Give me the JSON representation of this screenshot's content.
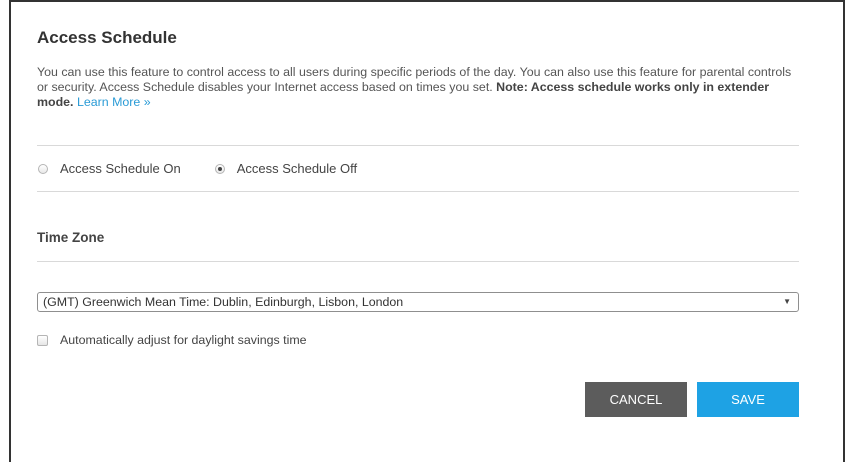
{
  "header": {
    "title": "Access Schedule"
  },
  "description": {
    "text": "You can use this feature to control access to all users during specific periods of the day. You can also use this feature for parental controls or security. Access Schedule disables your Internet access based on times you set.",
    "note": "Note: Access schedule works only in extender mode.",
    "link": "Learn More »"
  },
  "schedule": {
    "options": [
      {
        "label": "Access Schedule On",
        "checked": false
      },
      {
        "label": "Access Schedule Off",
        "checked": true
      }
    ]
  },
  "timezone": {
    "title": "Time Zone",
    "selected": "(GMT) Greenwich Mean Time: Dublin, Edinburgh, Lisbon, London",
    "dst_label": "Automatically adjust for daylight savings time",
    "dst_checked": false
  },
  "buttons": {
    "cancel": "CANCEL",
    "save": "SAVE"
  },
  "colors": {
    "link": "#2a9bd6",
    "save": "#1ea2e4",
    "cancel": "#5c5c5c"
  }
}
